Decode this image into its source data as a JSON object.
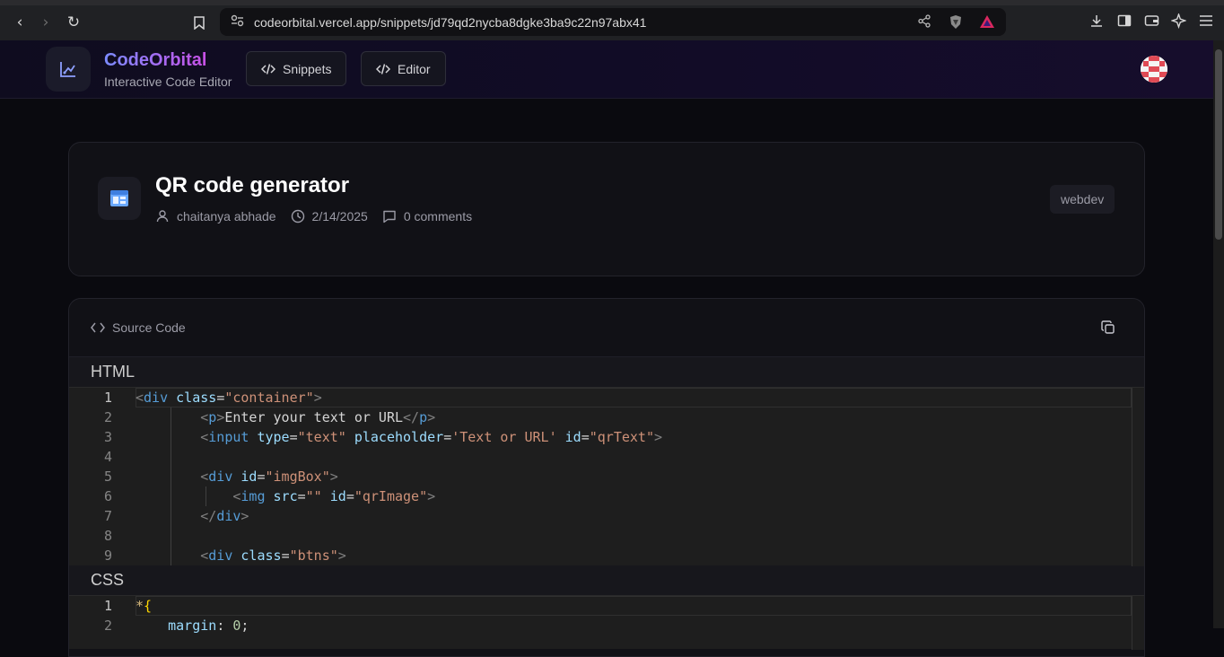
{
  "browser": {
    "url": "codeorbital.vercel.app/snippets/jd79qd2nycba8dgke3ba9c22n97abx41"
  },
  "header": {
    "brand": "CodeOrbital",
    "tagline": "Interactive Code Editor",
    "nav": [
      {
        "label": "Snippets",
        "icon": "code-icon"
      },
      {
        "label": "Editor",
        "icon": "code-icon"
      }
    ]
  },
  "snippet": {
    "title": "QR code generator",
    "author": "chaitanya abhade",
    "date": "2/14/2025",
    "comments": "0 comments",
    "tag": "webdev"
  },
  "source": {
    "heading": "Source Code",
    "html_label": "HTML",
    "css_label": "CSS",
    "html_lines": [
      {
        "n": "1",
        "text": "<div class=\"container\">"
      },
      {
        "n": "2",
        "text": "        <p>Enter your text or URL</p>"
      },
      {
        "n": "3",
        "text": "        <input type=\"text\" placeholder='Text or URL' id=\"qrText\">"
      },
      {
        "n": "4",
        "text": ""
      },
      {
        "n": "5",
        "text": "        <div id=\"imgBox\">"
      },
      {
        "n": "6",
        "text": "            <img src=\"\" id=\"qrImage\">"
      },
      {
        "n": "7",
        "text": "        </div>"
      },
      {
        "n": "8",
        "text": ""
      },
      {
        "n": "9",
        "text": "        <div class=\"btns\">"
      }
    ],
    "css_lines": [
      {
        "n": "1",
        "text": "*{"
      },
      {
        "n": "2",
        "text": "    margin: 0;"
      }
    ]
  }
}
